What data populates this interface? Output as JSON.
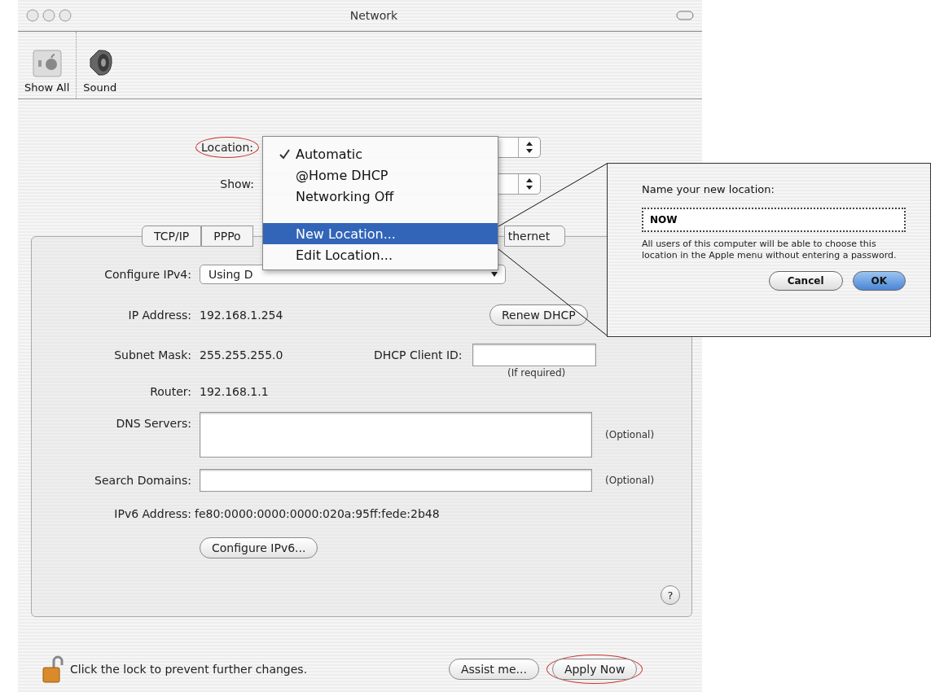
{
  "window": {
    "title": "Network"
  },
  "toolbar": [
    {
      "label": "Show All",
      "kind": "show_all"
    },
    {
      "label": "Sound",
      "kind": "sound"
    }
  ],
  "location": {
    "label": "Location:",
    "highlighted": true
  },
  "show": {
    "label": "Show:"
  },
  "location_menu": {
    "items": [
      {
        "kind": "item",
        "label": "Automatic",
        "checked": true,
        "selected": false
      },
      {
        "kind": "item",
        "label": "@Home DHCP",
        "checked": false,
        "selected": false
      },
      {
        "kind": "item",
        "label": "Networking Off",
        "checked": false,
        "selected": false
      },
      {
        "kind": "separator"
      },
      {
        "kind": "item",
        "label": "New Location...",
        "checked": false,
        "selected": true
      },
      {
        "kind": "item",
        "label": "Edit Location...",
        "checked": false,
        "selected": false
      }
    ]
  },
  "tabs": [
    {
      "label": "TCP/IP"
    },
    {
      "label": "PPPo"
    },
    {
      "label": "thernet"
    }
  ],
  "tcpip": {
    "configure": {
      "label": "Configure IPv4:",
      "value": "Using D"
    },
    "ip_address": {
      "label": "IP Address:",
      "value": "192.168.1.254"
    },
    "renew_button": "Renew DHCP",
    "subnet_mask": {
      "label": "Subnet Mask:",
      "value": "255.255.255.0"
    },
    "dhcp_client_id": {
      "label": "DHCP Client ID:",
      "hint": "(If required)"
    },
    "router": {
      "label": "Router:",
      "value": "192.168.1.1"
    },
    "dns_servers": {
      "label": "DNS Servers:",
      "hint": "(Optional)"
    },
    "search_domains": {
      "label": "Search Domains:",
      "hint": "(Optional)"
    },
    "ipv6_address": {
      "label": "IPv6 Address:",
      "value": "fe80:0000:0000:0000:020a:95ff:fede:2b48"
    },
    "configure_ipv6_button": "Configure IPv6...",
    "help": "?"
  },
  "footer": {
    "lock_text": "Click the lock to prevent further changes.",
    "buttons": [
      {
        "label": "Assist me...",
        "highlighted": false
      },
      {
        "label": "Apply Now",
        "highlighted": true
      }
    ]
  },
  "dialog": {
    "prompt": "Name your new location:",
    "value": "NOW",
    "note": "All users of this computer will be able to choose this location in the Apple menu without entering a password.",
    "buttons": [
      {
        "label": "Cancel",
        "default": false
      },
      {
        "label": "OK",
        "default": true
      }
    ]
  }
}
